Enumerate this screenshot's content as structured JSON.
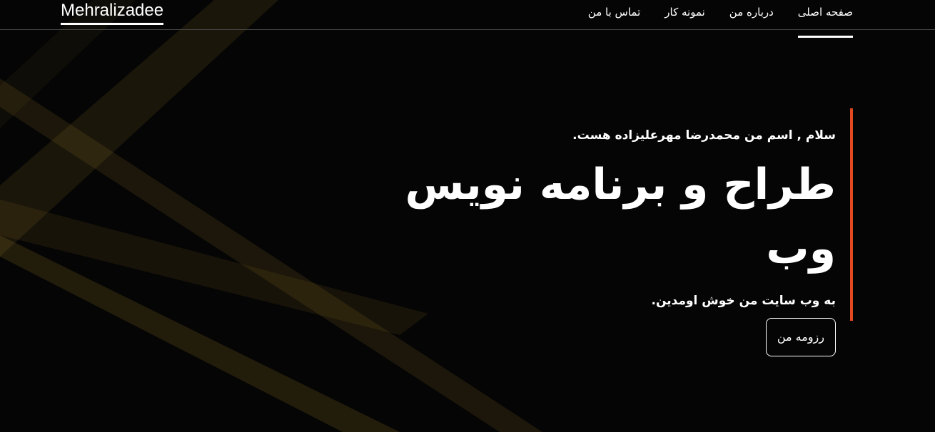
{
  "header": {
    "logo": "Mehralizadee",
    "nav": [
      {
        "label": "صفحه اصلی",
        "active": true
      },
      {
        "label": "درباره من",
        "active": false
      },
      {
        "label": "نمونه کار",
        "active": false
      },
      {
        "label": "تماس با من",
        "active": false
      }
    ]
  },
  "hero": {
    "greeting": "سلام , اسم من محمدرضا مهرعلیزاده هست.",
    "title": "طراح و برنامه نویس وب",
    "welcome": "به وب سایت من خوش اومدین.",
    "resume_button": "رزومه من"
  },
  "colors": {
    "accent": "#e2491f",
    "background": "#050505",
    "beam": "#b8962e"
  }
}
